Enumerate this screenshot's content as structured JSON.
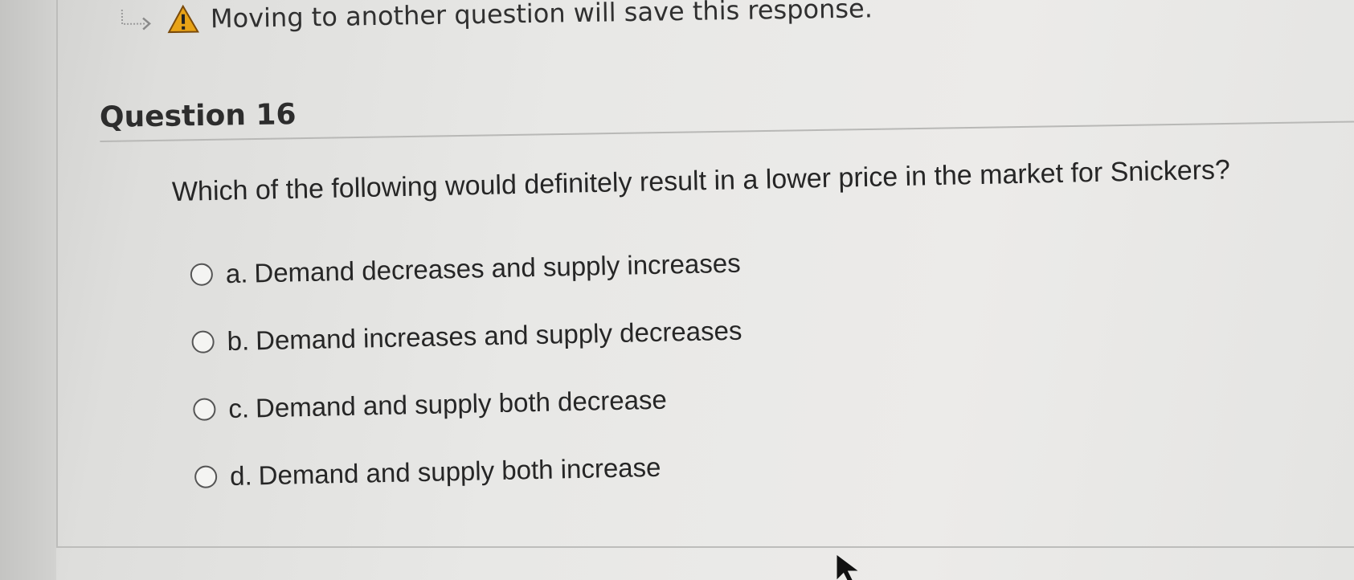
{
  "notice": {
    "text": "Moving to another question will save this response.",
    "arrow_icon": "dotted-arrow-icon",
    "warning_icon": "warning-triangle-icon",
    "warning_color": "#e8a317"
  },
  "question": {
    "title": "Question 16",
    "prompt": "Which of the following would definitely result in a lower price in the market for Snickers?",
    "options": [
      {
        "letter": "a.",
        "label": "Demand decreases and supply increases"
      },
      {
        "letter": "b.",
        "label": "Demand increases and supply decreases"
      },
      {
        "letter": "c.",
        "label": "Demand and supply both decrease"
      },
      {
        "letter": "d.",
        "label": "Demand and supply both increase"
      }
    ]
  }
}
